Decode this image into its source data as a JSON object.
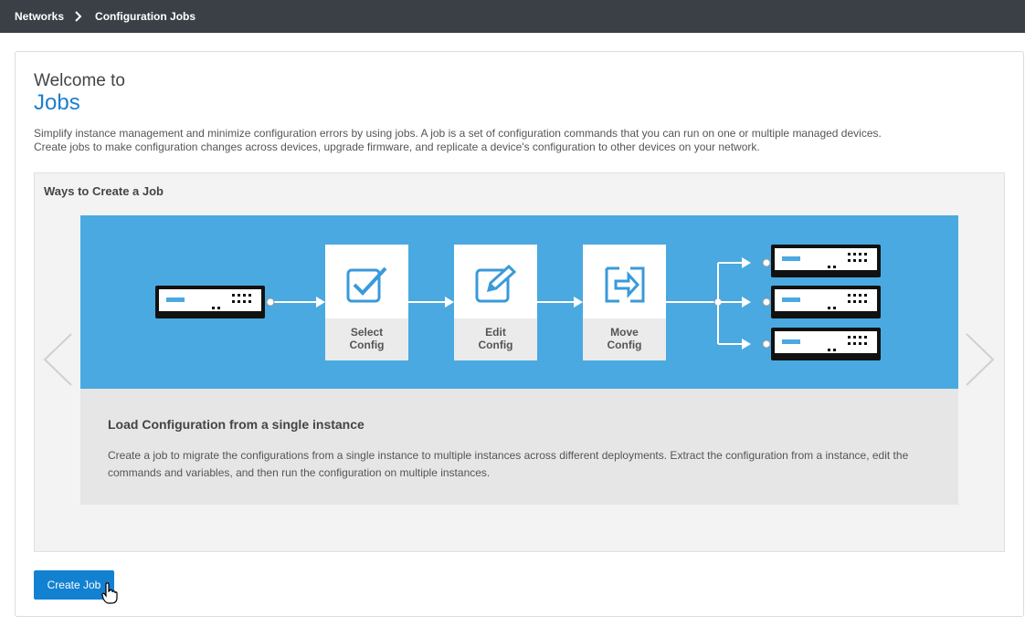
{
  "breadcrumb": {
    "root": "Networks",
    "current": "Configuration Jobs"
  },
  "header": {
    "welcome": "Welcome to",
    "title": "Jobs",
    "description_line1": "Simplify instance management and minimize configuration errors by using jobs. A job is a set of configuration commands that you can run on one or multiple managed devices.",
    "description_line2": "Create jobs to make configuration changes across devices, upgrade firmware, and replicate a device's configuration to other devices on your network."
  },
  "ways": {
    "title": "Ways to Create a Job",
    "steps": [
      {
        "line1": "Select",
        "line2": "Config",
        "icon": "checkbox-icon"
      },
      {
        "line1": "Edit",
        "line2": "Config",
        "icon": "edit-icon"
      },
      {
        "line1": "Move",
        "line2": "Config",
        "icon": "move-icon"
      }
    ],
    "slide_title": "Load Configuration from a single instance",
    "slide_text": "Create a job to migrate the configurations from a single instance to multiple instances across different deployments. Extract the configuration from a instance, edit the commands and variables, and then run the configuration on multiple instances."
  },
  "actions": {
    "create_job": "Create Job"
  },
  "colors": {
    "topbar": "#3b4047",
    "accent": "#1c7fcb",
    "diagram_bg": "#4aa9e0",
    "button": "#1381d2"
  }
}
